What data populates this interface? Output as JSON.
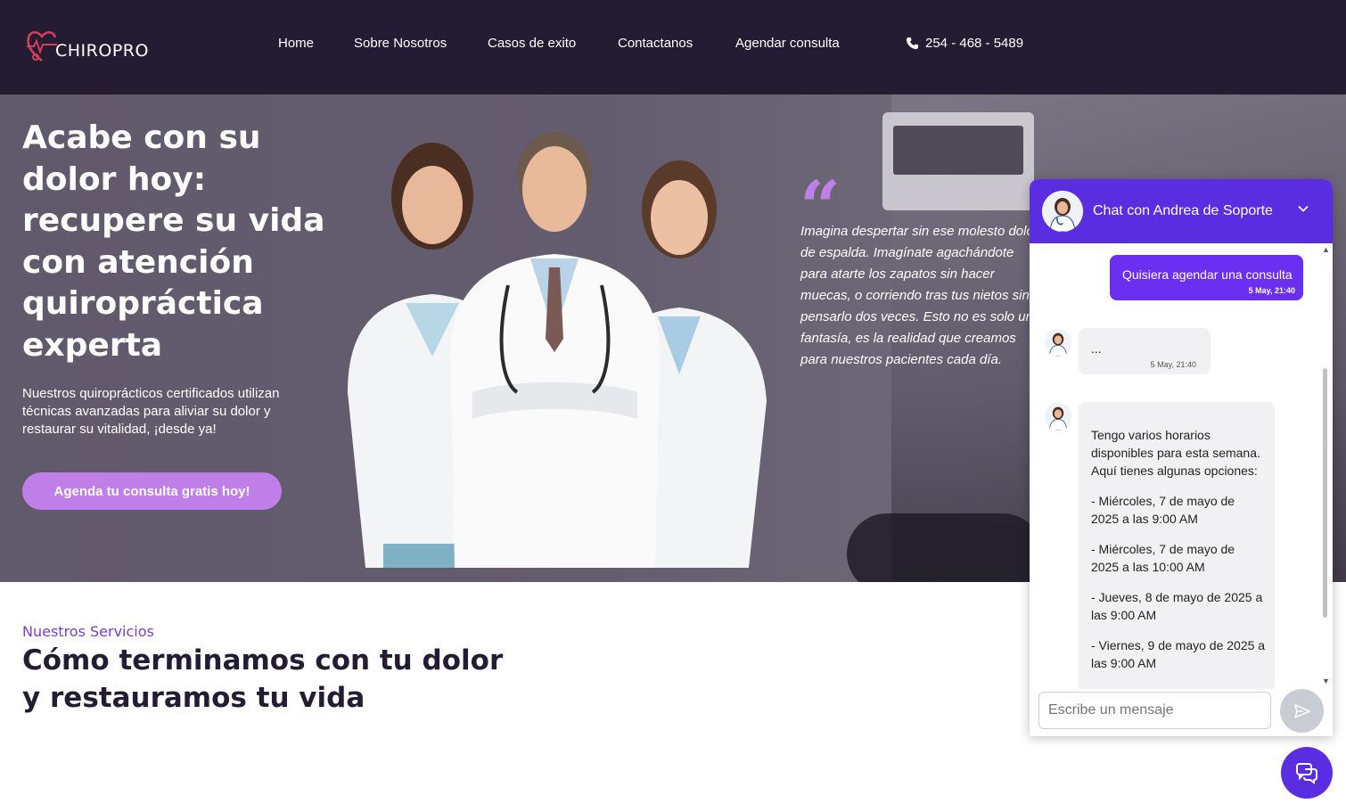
{
  "brand": {
    "name": "CHIROPRO",
    "accent": "#d63f5c"
  },
  "nav": {
    "items": [
      "Home",
      "Sobre Nosotros",
      "Casos de exito",
      "Contactanos",
      "Agendar consulta"
    ],
    "phone": "254 - 468 - 5489"
  },
  "hero": {
    "title": "Acabe con su dolor hoy: recupere su vida con atención quiropráctica experta",
    "subtitle": "Nuestros quiroprácticos certificados utilizan técnicas avanzadas para aliviar su dolor y restaurar su vitalidad, ¡desde ya!",
    "cta": "Agenda tu consulta gratis hoy!",
    "quote": "Imagina despertar sin ese molesto dolor de espalda. Imagínate agachándote para atarte los zapatos sin hacer muecas, o corriendo tras tus nietos sin pensarlo dos veces. Esto no es solo una fantasía, es la realidad que creamos para nuestros pacientes cada día."
  },
  "services": {
    "kicker": "Nuestros Servicios",
    "title": "Cómo terminamos con tu dolor y restauramos tu vida"
  },
  "chat": {
    "title": "Chat con Andrea de Soporte",
    "user_message": {
      "text": "Quisiera agendar una consulta",
      "time": "5 May, 21:40"
    },
    "bot_message_1": {
      "text": "...",
      "time": "5 May, 21:40"
    },
    "bot_message_2": {
      "lines": [
        "Tengo varios horarios",
        "disponibles para esta semana.",
        "Aquí tienes algunas opciones:",
        "- Miércoles, 7 de mayo de",
        "2025 a las 9:00 AM",
        "- Miércoles, 7 de mayo de",
        "2025 a las 10:00 AM",
        "- Jueves, 8 de mayo de 2025 a",
        "las 9:00 AM",
        "- Viernes, 9 de mayo de 2025 a",
        "las 9:00 AM"
      ]
    },
    "input_placeholder": "Escribe un mensaje"
  },
  "colors": {
    "header_bg": "#231c33",
    "cta": "#c07ee8",
    "chat_accent": "#5b2de0",
    "user_bubble": "#6a2ff0",
    "kicker": "#7b3fc4"
  }
}
